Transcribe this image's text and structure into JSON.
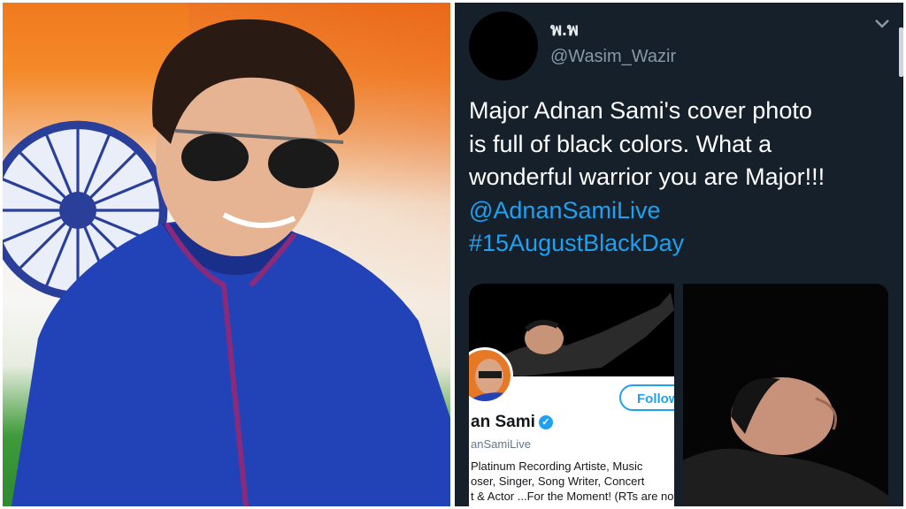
{
  "tweet": {
    "display_name": "พ.พ",
    "handle": "@Wasim_Wazir",
    "text_lines": [
      "Major Adnan Sami's cover photo",
      "is full of black colors. What a",
      "wonderful warrior you are Major!!!"
    ],
    "mention": "@AdnanSamiLive",
    "hashtag": "#15AugustBlackDay"
  },
  "media_profile": {
    "follow_label": "Follow",
    "name": "an Sami",
    "verified_mark": "✓",
    "handle": "anSamiLive",
    "bio_lines": [
      "Platinum Recording Artiste, Music",
      "oser, Singer, Song Writer, Concert",
      "t & Actor ...For the Moment! (RTs are not"
    ]
  },
  "colors": {
    "tweet_background": "#15202b",
    "link_blue": "#1da1f2",
    "saffron": "#f07a1e",
    "india_green": "#2f8a30",
    "kurta_blue": "#1f3fb0"
  },
  "icons": {
    "menu": "chevron-down-icon",
    "verified": "verified-badge-icon",
    "flag_wheel": "ashoka-chakra-icon"
  }
}
